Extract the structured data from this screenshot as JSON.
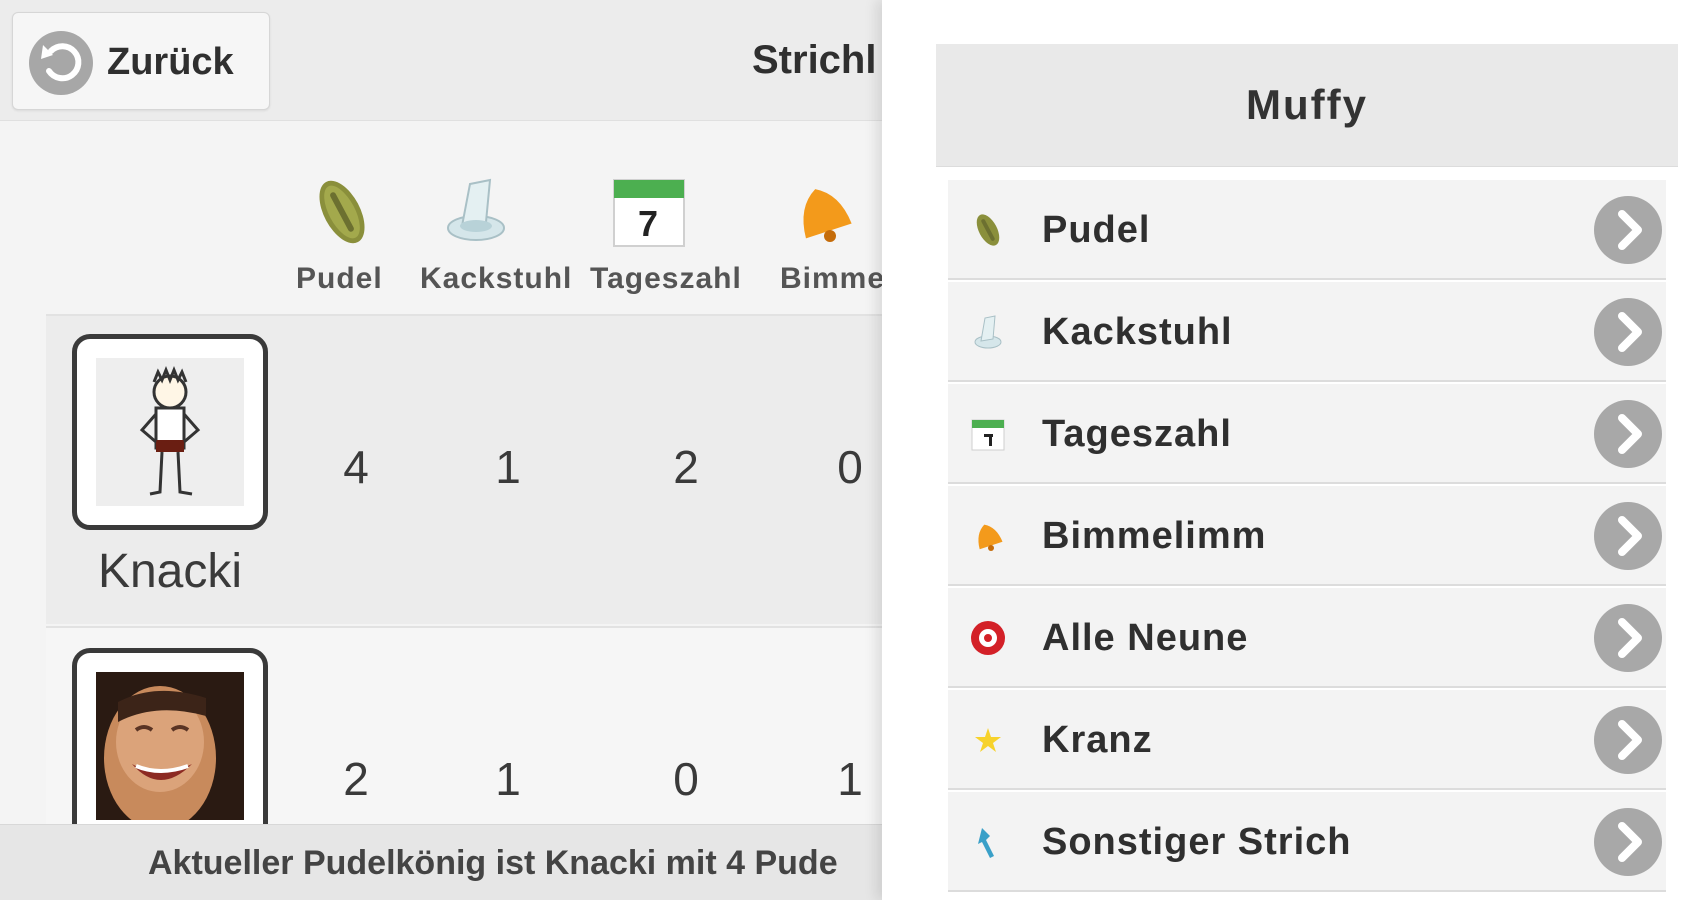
{
  "header": {
    "back_label": "Zurück",
    "title": "Strichl"
  },
  "columns": [
    {
      "label": "Pudel",
      "icon": "pudel-icon"
    },
    {
      "label": "Kackstuhl",
      "icon": "toilet-icon"
    },
    {
      "label": "Tageszahl",
      "icon": "calendar-icon",
      "calendar_day": "7"
    },
    {
      "label": "Bimme",
      "icon": "bell-icon"
    }
  ],
  "players": [
    {
      "name": "Knacki",
      "avatar": "stick-figure-avatar",
      "scores": [
        "4",
        "1",
        "2",
        "0"
      ]
    },
    {
      "name": "",
      "avatar": "photo-avatar",
      "scores": [
        "2",
        "1",
        "0",
        "1"
      ]
    }
  ],
  "footer": {
    "text": "Aktueller Pudelkönig ist Knacki mit 4 Pude"
  },
  "panel": {
    "title": "Muffy",
    "items": [
      {
        "label": "Pudel",
        "icon": "pudel-icon"
      },
      {
        "label": "Kackstuhl",
        "icon": "toilet-icon"
      },
      {
        "label": "Tageszahl",
        "icon": "calendar-icon"
      },
      {
        "label": "Bimmelimm",
        "icon": "bell-icon"
      },
      {
        "label": "Alle Neune",
        "icon": "target-icon"
      },
      {
        "label": "Kranz",
        "icon": "star-icon"
      },
      {
        "label": "Sonstiger Strich",
        "icon": "pin-icon"
      }
    ]
  },
  "colors": {
    "arrow_button": "#a8a8a8",
    "header_bg": "#ececec",
    "row_bg": "#ececec"
  }
}
